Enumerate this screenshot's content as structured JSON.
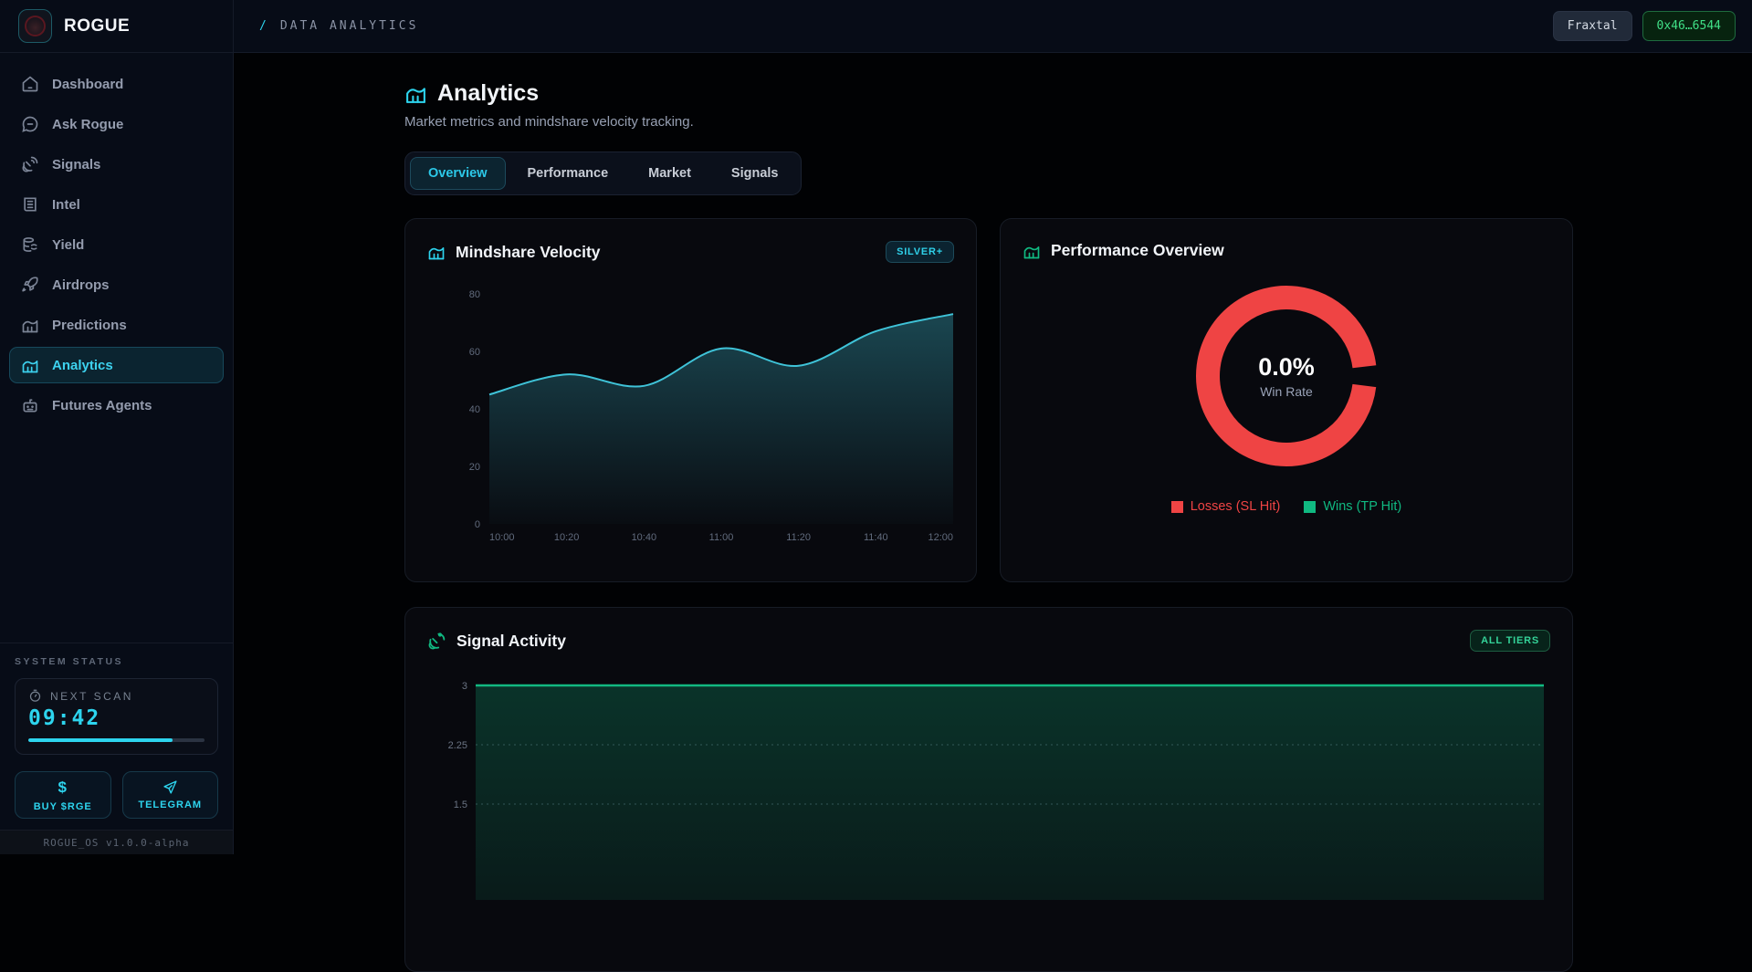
{
  "app": {
    "name": "ROGUE",
    "footer_version": "ROGUE_OS v1.0.0-alpha"
  },
  "topbar": {
    "breadcrumb_slash": "/",
    "breadcrumb": "DATA ANALYTICS",
    "network_button": "Fraxtal",
    "wallet_button": "0x46…6544"
  },
  "sidebar": {
    "items": [
      {
        "label": "Dashboard",
        "icon": "home-icon",
        "active": false
      },
      {
        "label": "Ask Rogue",
        "icon": "chat-icon",
        "active": false
      },
      {
        "label": "Signals",
        "icon": "satellite-icon",
        "active": false
      },
      {
        "label": "Intel",
        "icon": "newspaper-icon",
        "active": false
      },
      {
        "label": "Yield",
        "icon": "coins-icon",
        "active": false
      },
      {
        "label": "Airdrops",
        "icon": "rocket-icon",
        "active": false
      },
      {
        "label": "Predictions",
        "icon": "chart-icon",
        "active": false
      },
      {
        "label": "Analytics",
        "icon": "chart-icon",
        "active": true
      },
      {
        "label": "Futures Agents",
        "icon": "robot-icon",
        "active": false
      }
    ],
    "system_status": {
      "section_label": "SYSTEM STATUS",
      "next_scan_label": "NEXT SCAN",
      "countdown": "09:42",
      "progress_pct": 82
    },
    "buy_button": "BUY $RGE",
    "telegram_button": "TELEGRAM"
  },
  "page": {
    "title": "Analytics",
    "subtitle": "Market metrics and mindshare velocity tracking.",
    "tabs": [
      {
        "label": "Overview",
        "active": true
      },
      {
        "label": "Performance",
        "active": false
      },
      {
        "label": "Market",
        "active": false
      },
      {
        "label": "Signals",
        "active": false
      }
    ]
  },
  "cards": {
    "mindshare": {
      "title": "Mindshare Velocity",
      "badge": "SILVER+",
      "chart_data": {
        "type": "area",
        "x": [
          "10:00",
          "10:20",
          "10:40",
          "11:00",
          "11:20",
          "11:40",
          "12:00"
        ],
        "values": [
          45,
          52,
          48,
          61,
          55,
          67,
          73
        ],
        "yticks": [
          0,
          20,
          40,
          60,
          80
        ],
        "ylim": [
          0,
          80
        ],
        "line_color": "#3fc3d8",
        "grid": false,
        "legend": "none"
      }
    },
    "performance": {
      "title": "Performance Overview",
      "center_value": "0.0%",
      "center_label": "Win Rate",
      "chart_data": {
        "type": "pie",
        "slices": [
          {
            "label": "Losses (SL Hit)",
            "value": 100,
            "color": "#ef4444"
          },
          {
            "label": "Wins (TP Hit)",
            "value": 0,
            "color": "#10b981"
          }
        ],
        "title": "Win Rate donut",
        "center_text": "0.0% Win Rate",
        "legend_position": "bottom"
      }
    },
    "signal": {
      "title": "Signal Activity",
      "badge": "ALL TIERS",
      "chart_data": {
        "type": "area",
        "values": [
          3,
          3
        ],
        "yticks_visible": [
          1.5,
          2.25,
          3
        ],
        "ylim_visible": [
          1.5,
          3
        ],
        "line_color": "#12b981",
        "grid": "dotted-horizontal",
        "note": "constant line at 3; lower part of chart cut off by viewport"
      }
    }
  },
  "colors": {
    "accent_cyan": "#2dd4ee",
    "accent_green": "#10b981",
    "accent_red": "#ef4444",
    "wallet_green": "#40e087",
    "sidebar_bg": "#070c17",
    "card_bg": "#08090e",
    "main_bg": "#010204"
  }
}
